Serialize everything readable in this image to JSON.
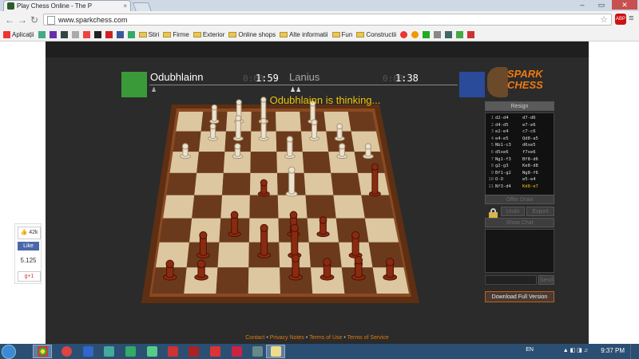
{
  "browser": {
    "tab_title": "Play Chess Online - The P",
    "tab_close": "×",
    "url": "www.sparkchess.com",
    "bookmarks": [
      "Aplicații",
      "Stiri",
      "Firme",
      "Exterior",
      "Online shops",
      "Alte informatii",
      "Fun",
      "Constructii"
    ],
    "abp_label": "ABP"
  },
  "game": {
    "player1": {
      "name": "Odubhlainn",
      "time": "1:59",
      "time_dim": "0:00"
    },
    "player2": {
      "name": "Lanius",
      "time": "1:38",
      "time_dim": "0:00"
    },
    "status": "Odubhlainn is thinking...",
    "logo_line1": "SPARK",
    "logo_line2": "CHESS",
    "resign_label": "Resign",
    "offer_draw_label": "Offer Draw",
    "undo_label": "Undo",
    "export_label": "Export PGN",
    "show_chat_label": "Show Chat",
    "send_label": "Send",
    "download_label": "Download Full Version",
    "moves": [
      {
        "n": "1",
        "w": "d2-d4",
        "b": "d7-d6"
      },
      {
        "n": "2",
        "w": "d4-d5",
        "b": "e7-e6"
      },
      {
        "n": "3",
        "w": "e2-e4",
        "b": "c7-c6"
      },
      {
        "n": "4",
        "w": "e4-e5",
        "b": "Qd8-a5"
      },
      {
        "n": "5",
        "w": "Nb1-c3",
        "b": "d6xe5"
      },
      {
        "n": "6",
        "w": "d5xe6",
        "b": "f7xe6"
      },
      {
        "n": "7",
        "w": "Ng1-f3",
        "b": "Bf8-d6"
      },
      {
        "n": "8",
        "w": "g2-g3",
        "b": "Ke8-d8"
      },
      {
        "n": "9",
        "w": "Bf1-g2",
        "b": "Ng8-f6"
      },
      {
        "n": "10",
        "w": "O-O",
        "b": "e5-e4"
      },
      {
        "n": "11",
        "w": "Nf3-d4",
        "b": "Kd8-e7"
      }
    ],
    "footer": {
      "contact": "Contact",
      "privacy": "Privacy Notes",
      "terms": "Terms of Use",
      "service": "Terms of Service",
      "sep": "•"
    }
  },
  "social": {
    "likes": "42k",
    "fb_label": "Like",
    "count": "5.125",
    "gplus": "g+1"
  },
  "taskbar": {
    "lang": "EN",
    "time": "9:37 PM"
  },
  "colors": {
    "accent": "#f2c200",
    "link": "#e07a10",
    "light_square": "#dcc7a0",
    "dark_square": "#6b3a1c"
  }
}
